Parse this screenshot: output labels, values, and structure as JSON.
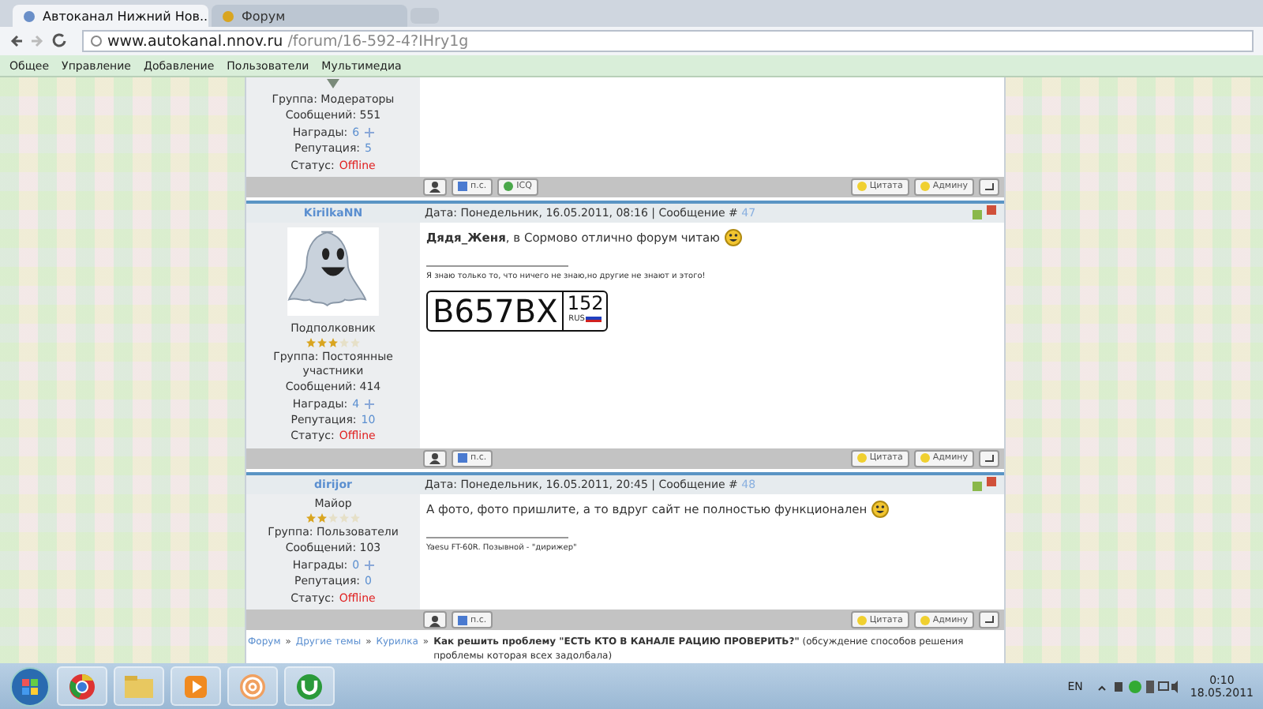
{
  "browser": {
    "tabs": [
      {
        "title": "Автоканал Нижний Нов...",
        "selected": true
      },
      {
        "title": "Форум",
        "selected": false
      }
    ],
    "url_host": "www.autokanal.nnov.ru",
    "url_path": "/forum/16-592-4?IHry1g",
    "bookmarks": [
      "Общее",
      "Управление",
      "Добавление",
      "Пользователи",
      "Мультимедиа"
    ]
  },
  "posts": [
    {
      "kind": "partial",
      "group": "Группа: Модераторы",
      "messages": "Сообщений: 551",
      "awards_label": "Награды:",
      "awards": "6",
      "reputation_label": "Репутация:",
      "reputation": "5",
      "status_label": "Статус:",
      "status": "Offline",
      "left_buttons": [
        "п.с.",
        "ICQ"
      ],
      "right_buttons": [
        "Цитата",
        "Админу"
      ]
    },
    {
      "kind": "full",
      "author": "KirilkaNN",
      "date": "Дата: Понедельник, 16.05.2011, 08:16 | Сообщение # ",
      "number": "47",
      "avatar": true,
      "rank": "Подполковник",
      "stars": 3,
      "group": "Группа: Постоянные участники",
      "messages": "Сообщений: 414",
      "awards_label": "Награды:",
      "awards": "4",
      "reputation_label": "Репутация:",
      "reputation": "10",
      "status_label": "Статус:",
      "status": "Offline",
      "text": "**Дядя_Женя**, в Сормово отлично форум читаю",
      "signature": "Я знаю только то, что ничего не знаю,но другие не знают и этого!",
      "plate": {
        "number": "В657ВХ",
        "region": "152",
        "country": "RUS"
      },
      "left_buttons": [
        "п.с."
      ],
      "right_buttons": [
        "Цитата",
        "Админу"
      ]
    },
    {
      "kind": "full",
      "author": "dirijor",
      "date": "Дата: Понедельник, 16.05.2011, 20:45 | Сообщение # ",
      "number": "48",
      "avatar": false,
      "rank": "Майор",
      "stars": 2,
      "group": "Группа: Пользователи",
      "messages": "Сообщений: 103",
      "awards_label": "Награды:",
      "awards": "0",
      "reputation_label": "Репутация:",
      "reputation": "0",
      "status_label": "Статус:",
      "status": "Offline",
      "text": "А фото, фото пришлите, а то вдруг сайт не полностью функционален",
      "signature": "Yaesu FT-60R. Позывной - \"дирижер\"",
      "left_buttons": [
        "п.с."
      ],
      "right_buttons": [
        "Цитата",
        "Админу"
      ]
    }
  ],
  "breadcrumb": {
    "links": [
      "Форум",
      "Другие темы",
      "Курилка"
    ],
    "separator": "»",
    "topic": "**Как решить проблему \"ЕСТЬ КТО В КАНАЛЕ РАЦИЮ ПРОВЕРИТЬ?\"** (обсуждение способов решения проблемы которая всех задолбала)"
  },
  "taskbar": {
    "language": "EN",
    "time": "0:10",
    "date": "18.05.2011"
  }
}
